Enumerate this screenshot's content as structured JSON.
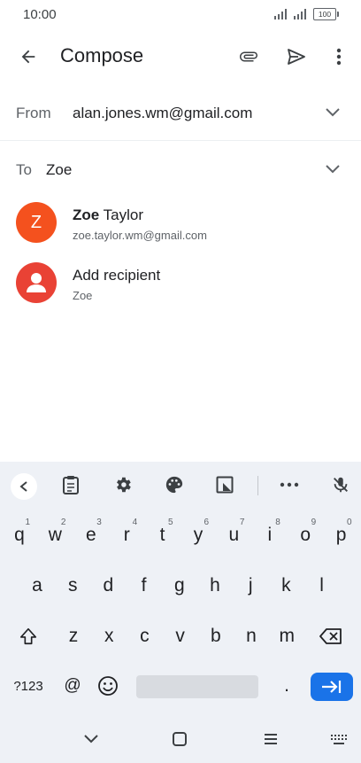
{
  "status": {
    "time": "10:00",
    "battery": "100"
  },
  "app_bar": {
    "title": "Compose"
  },
  "from": {
    "label": "From",
    "value": "alan.jones.wm@gmail.com"
  },
  "to": {
    "label": "To",
    "value": "Zoe"
  },
  "suggestions": [
    {
      "avatar_letter": "Z",
      "name_bold": "Zoe",
      "name_rest": " Taylor",
      "email": "zoe.taylor.wm@gmail.com",
      "color": "#f4511e"
    },
    {
      "name": "Add recipient",
      "sub": "Zoe",
      "color": "#e94235"
    }
  ],
  "keyboard": {
    "row1": [
      {
        "k": "q",
        "h": "1"
      },
      {
        "k": "w",
        "h": "2"
      },
      {
        "k": "e",
        "h": "3"
      },
      {
        "k": "r",
        "h": "4"
      },
      {
        "k": "t",
        "h": "5"
      },
      {
        "k": "y",
        "h": "6"
      },
      {
        "k": "u",
        "h": "7"
      },
      {
        "k": "i",
        "h": "8"
      },
      {
        "k": "o",
        "h": "9"
      },
      {
        "k": "p",
        "h": "0"
      }
    ],
    "row2": [
      "a",
      "s",
      "d",
      "f",
      "g",
      "h",
      "j",
      "k",
      "l"
    ],
    "row3": [
      "z",
      "x",
      "c",
      "v",
      "b",
      "n",
      "m"
    ],
    "sym_label": "?123",
    "at_label": "@",
    "period_label": "."
  },
  "colors": {
    "accent": "#1a73e8",
    "keyboard_bg": "#eef1f6"
  }
}
